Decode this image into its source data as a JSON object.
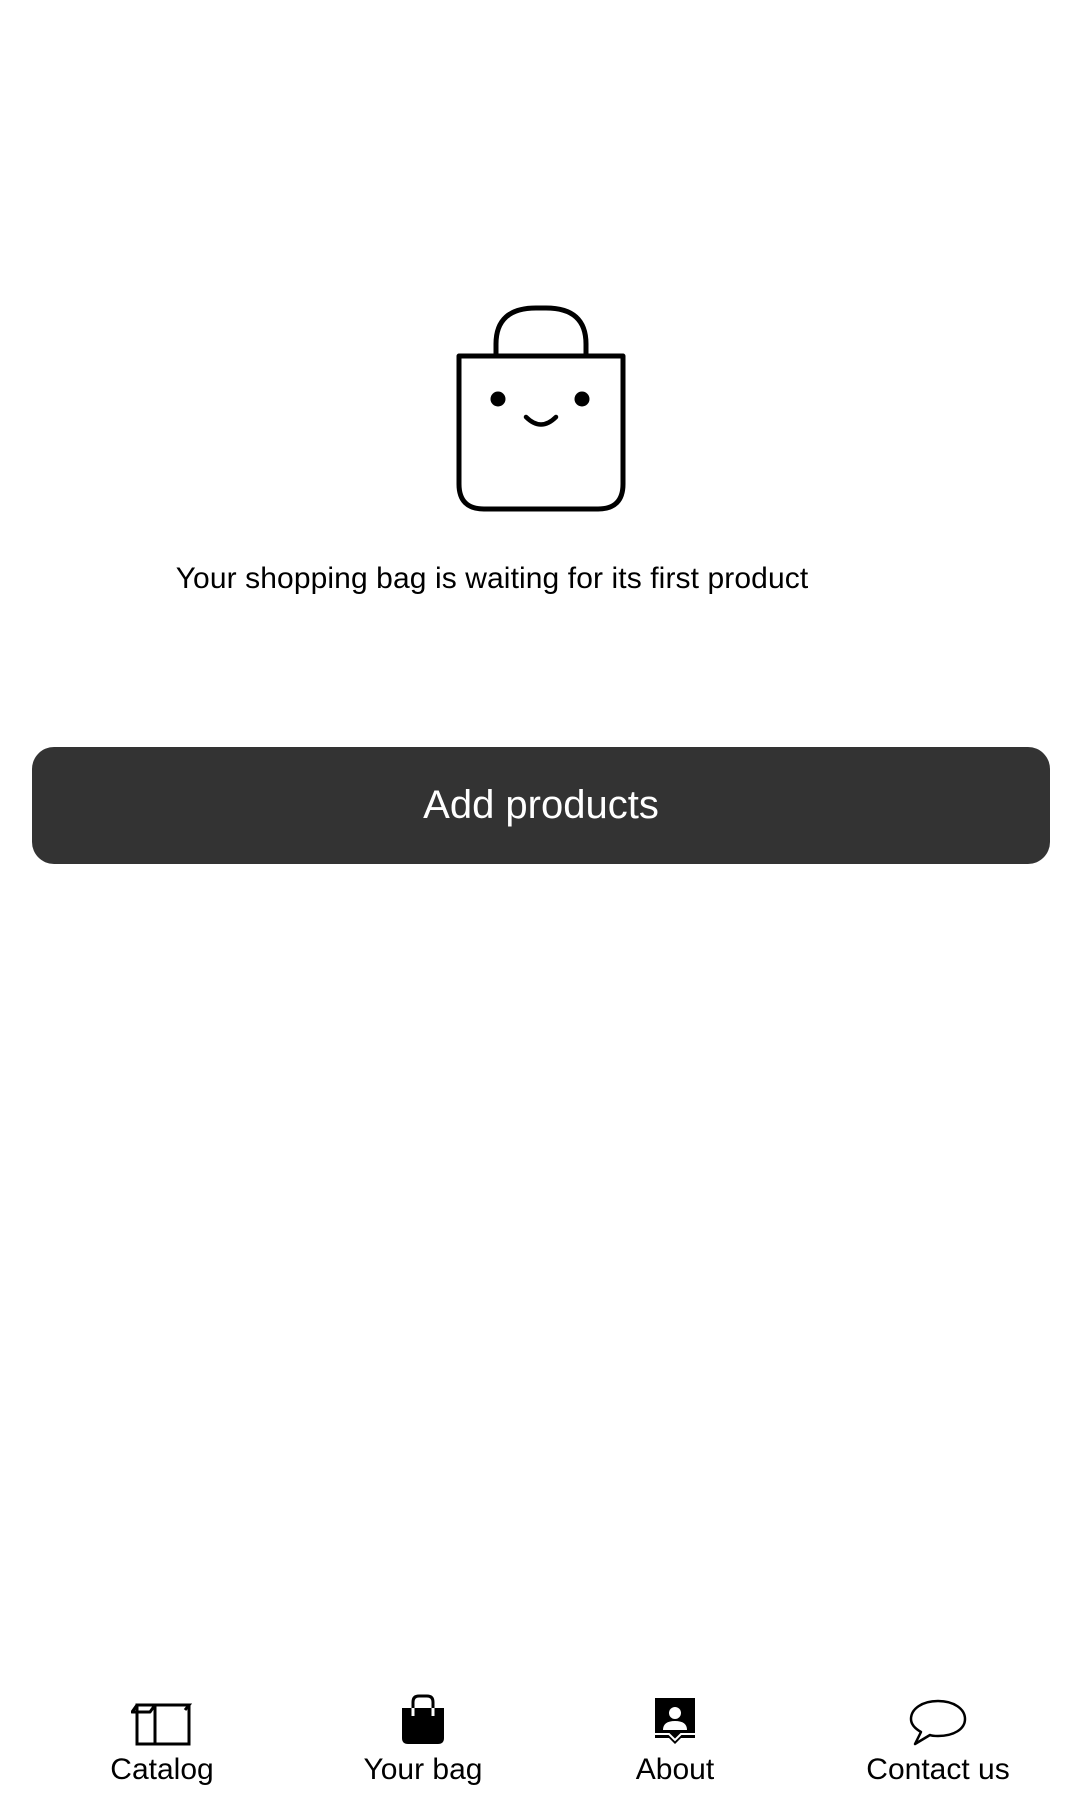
{
  "empty_state": {
    "illustration": "smiling-shopping-bag-icon",
    "message": "Your shopping bag is waiting for its first product",
    "button_label": "Add products",
    "button_color": "#333333"
  },
  "bottom_nav": {
    "items": [
      {
        "label": "Catalog",
        "icon": "box-icon"
      },
      {
        "label": "Your bag",
        "icon": "shopping-bag-icon"
      },
      {
        "label": "About",
        "icon": "profile-card-icon"
      },
      {
        "label": "Contact us",
        "icon": "speech-bubble-icon"
      }
    ]
  }
}
